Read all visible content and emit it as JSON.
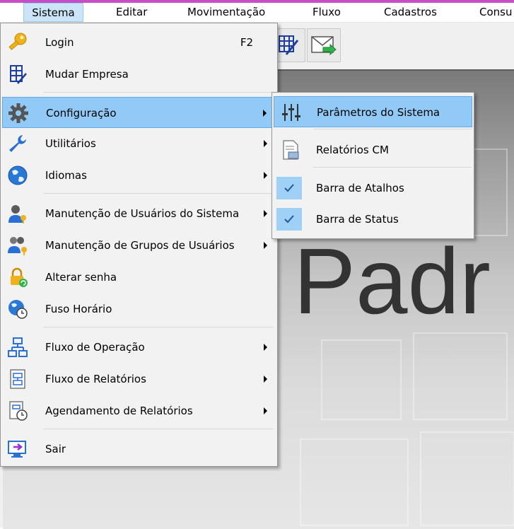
{
  "menubar": {
    "items": [
      "Sistema",
      "Editar",
      "Movimentação",
      "Fluxo",
      "Cadastros",
      "Consu"
    ],
    "active": "Sistema"
  },
  "background": {
    "text": "Padr"
  },
  "menu": {
    "items": [
      {
        "label": "Login",
        "shortcut": "F2",
        "icon": "key-icon"
      },
      {
        "label": "Mudar Empresa",
        "icon": "building-icon"
      },
      {
        "label": "Configuração",
        "icon": "gear-icon",
        "submenu": true,
        "highlighted": true
      },
      {
        "label": "Utilitários",
        "icon": "wrench-icon",
        "submenu": true
      },
      {
        "label": "Idiomas",
        "icon": "globe-icon",
        "submenu": true
      },
      {
        "label": "Manutenção de Usuários do Sistema",
        "icon": "user-icon",
        "submenu": true
      },
      {
        "label": "Manutenção de Grupos de Usuários",
        "icon": "user-group-icon",
        "submenu": true
      },
      {
        "label": "Alterar senha",
        "icon": "lock-icon"
      },
      {
        "label": "Fuso Horário",
        "icon": "globe-clock-icon"
      },
      {
        "label": "Fluxo de Operação",
        "icon": "flowchart-icon",
        "submenu": true
      },
      {
        "label": "Fluxo de Relatórios",
        "icon": "report-flow-icon",
        "submenu": true
      },
      {
        "label": "Agendamento de Relatórios",
        "icon": "report-schedule-icon",
        "submenu": true
      },
      {
        "label": "Sair",
        "icon": "exit-icon"
      }
    ]
  },
  "submenu": {
    "items": [
      {
        "label": "Parâmetros do Sistema",
        "icon": "sliders-icon",
        "highlighted": true
      },
      {
        "label": "Relatórios CM",
        "icon": "report-icon"
      },
      {
        "label": "Barra de Atalhos",
        "checked": true
      },
      {
        "label": "Barra de Status",
        "checked": true
      }
    ]
  },
  "colors": {
    "accent_stripe": "#c44fc4",
    "highlight": "#91c9f7",
    "menu_background": "#f2f2f2"
  }
}
